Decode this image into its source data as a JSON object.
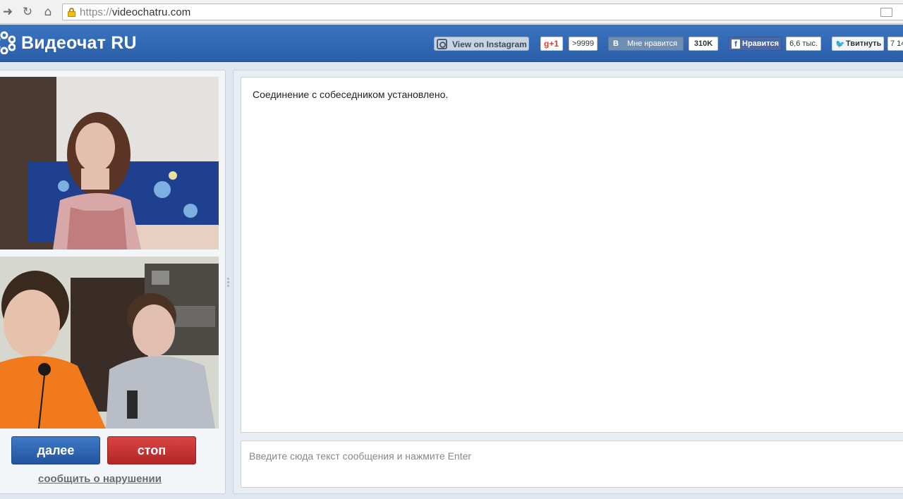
{
  "browser": {
    "back_icon": "arrow-right-icon",
    "reload_icon": "reload-icon",
    "home_icon": "home-icon",
    "url_scheme": "https://",
    "url_host": "videochatru.com"
  },
  "header": {
    "logo_text": "Видеочат RU",
    "accent_color": "#2f66b1",
    "instagram_label": "View on Instagram",
    "gplus_label": "g+1",
    "gplus_count": ">9999",
    "vk_letter": "В",
    "vk_label": "Мне нравится",
    "vk_count": "310K",
    "fb_letter": "f",
    "fb_label": "Нравится",
    "fb_count": "6,6 тыс.",
    "tw_label": "Твитнуть",
    "tw_count": "7 14"
  },
  "controls": {
    "next_label": "далее",
    "stop_label": "стоп",
    "report_label": "сообщить о нарушении",
    "next_color": "#2e62ae",
    "stop_color": "#c43434"
  },
  "chat": {
    "messages": [
      {
        "text": "Соединение с собеседником установлено."
      }
    ],
    "input_placeholder": "Введите сюда текст сообщения и нажмите Enter"
  }
}
